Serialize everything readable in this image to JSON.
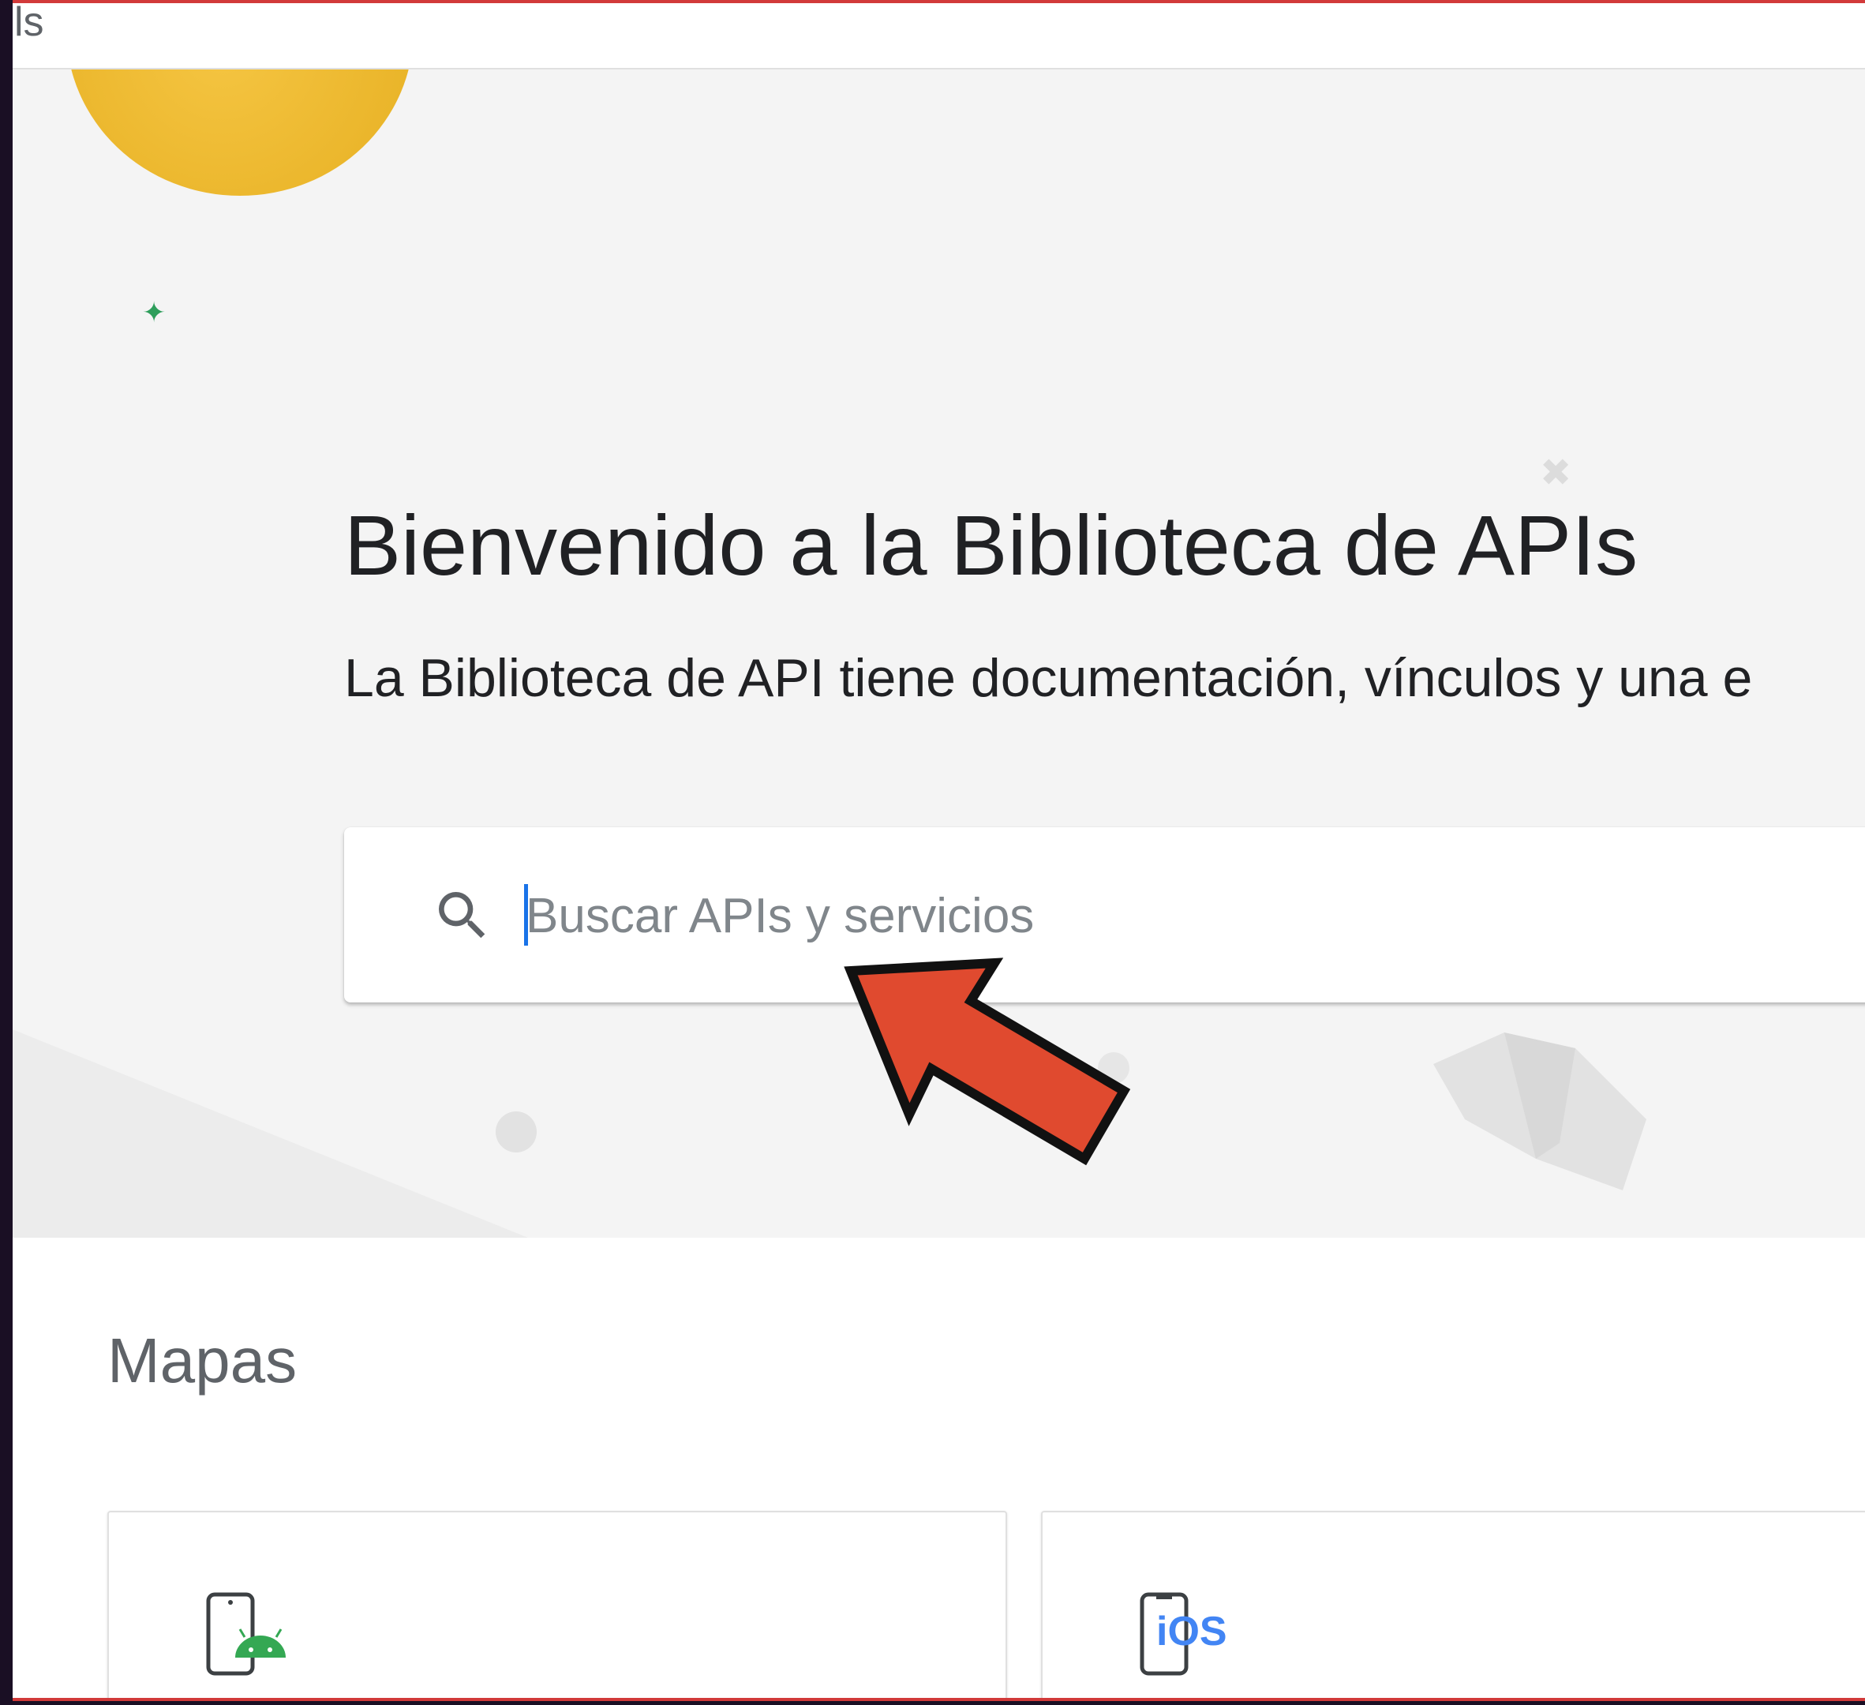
{
  "topbar": {
    "title_fragment": "ls"
  },
  "hero": {
    "title": "Bienvenido a la Biblioteca de APIs",
    "subtitle": "La Biblioteca de API tiene documentación, vínculos y una e"
  },
  "search": {
    "placeholder": "Buscar APIs y servicios",
    "value": "",
    "icon": "search-icon"
  },
  "section": {
    "title": "Mapas",
    "cards": [
      {
        "icon": "android-phone-icon",
        "label_icon": "android"
      },
      {
        "icon": "ios-phone-icon",
        "label_icon": "iOS",
        "icon_text": "iOS"
      }
    ]
  },
  "colors": {
    "page_bg": "#f4f4f4",
    "sun": "#eab52a",
    "sparkle": "#2e9e5b",
    "android_green": "#34a853",
    "ios_blue": "#4285f4",
    "caret": "#1a73e8",
    "annotation_arrow": "#e04a2f",
    "frame_border": "#d23a3a"
  }
}
